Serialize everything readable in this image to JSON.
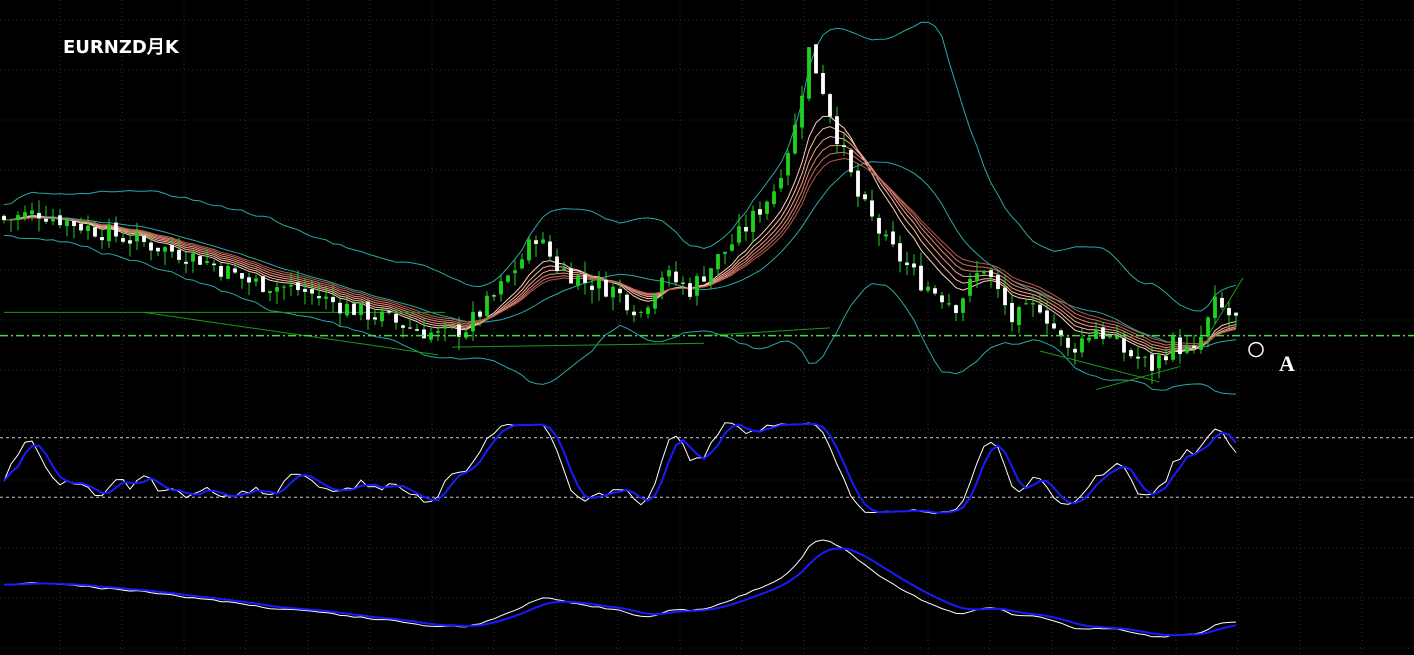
{
  "chart_data": {
    "type": "candlestick",
    "title": "EURNZD月K",
    "marker_label": "A",
    "grid": true,
    "colors": {
      "background": "#000000",
      "grid": "#2f2f2f",
      "candle_up": "#1fd01f",
      "candle_down": "#ffffff",
      "bollinger": "#2aa7a7",
      "ribbon": [
        "#ffd0c0",
        "#ffb8a0",
        "#f9a08a",
        "#e58a78",
        "#cf7060",
        "#b85a4c"
      ],
      "stoch_fast": "#ffffff",
      "stoch_slow": "#1a1aff",
      "level_line": "#4cd64c",
      "trend_line": "#1a9a1a"
    },
    "price_panel": {
      "ylim": [
        1.4,
        2.45
      ]
    },
    "current_level": 1.58,
    "candles_count": 177,
    "price_path": [
      [
        0,
        1.88
      ],
      [
        5,
        1.9
      ],
      [
        12,
        1.86
      ],
      [
        20,
        1.82
      ],
      [
        28,
        1.78
      ],
      [
        35,
        1.72
      ],
      [
        42,
        1.7
      ],
      [
        48,
        1.66
      ],
      [
        55,
        1.62
      ],
      [
        62,
        1.58
      ],
      [
        66,
        1.6
      ],
      [
        70,
        1.68
      ],
      [
        74,
        1.78
      ],
      [
        76,
        1.84
      ],
      [
        79,
        1.76
      ],
      [
        83,
        1.72
      ],
      [
        87,
        1.7
      ],
      [
        91,
        1.64
      ],
      [
        94,
        1.74
      ],
      [
        98,
        1.7
      ],
      [
        102,
        1.78
      ],
      [
        106,
        1.86
      ],
      [
        110,
        1.96
      ],
      [
        113,
        2.12
      ],
      [
        115,
        2.32
      ],
      [
        117,
        2.22
      ],
      [
        119,
        2.1
      ],
      [
        122,
        1.94
      ],
      [
        126,
        1.82
      ],
      [
        131,
        1.72
      ],
      [
        136,
        1.66
      ],
      [
        140,
        1.76
      ],
      [
        144,
        1.62
      ],
      [
        148,
        1.66
      ],
      [
        152,
        1.54
      ],
      [
        156,
        1.6
      ],
      [
        160,
        1.54
      ],
      [
        164,
        1.5
      ],
      [
        167,
        1.56
      ],
      [
        170,
        1.53
      ],
      [
        173,
        1.66
      ],
      [
        176,
        1.62
      ]
    ],
    "stochastic_panel": {
      "ylim": [
        0,
        100
      ],
      "levels": [
        80,
        20
      ]
    },
    "lower_panel": {
      "ylim": [
        0,
        100
      ]
    }
  }
}
